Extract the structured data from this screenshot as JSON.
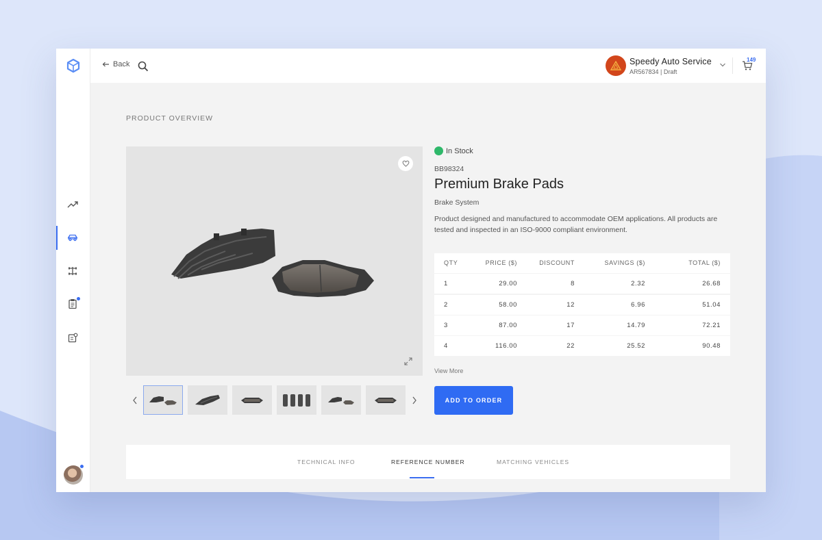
{
  "header": {
    "back_label": "Back",
    "account_name": "Speedy Auto Service",
    "account_sub": "AR567834  |  Draft",
    "cart_count": "149"
  },
  "page": {
    "section_title": "PRODUCT OVERVIEW"
  },
  "product": {
    "stock_status": "In Stock",
    "sku": "BB98324",
    "name": "Premium Brake Pads",
    "category": "Brake System",
    "description": "Product designed and manufactured to accommodate OEM applications. All products are tested and inspected in an ISO-9000 compliant environment."
  },
  "price_table": {
    "headers": [
      "QTY",
      "PRICE ($)",
      "DISCOUNT",
      "SAVINGS ($)",
      "TOTAL ($)"
    ],
    "rows": [
      [
        "1",
        "29.00",
        "8",
        "2.32",
        "26.68"
      ],
      [
        "2",
        "58.00",
        "12",
        "6.96",
        "51.04"
      ],
      [
        "3",
        "87.00",
        "17",
        "14.79",
        "72.21"
      ],
      [
        "4",
        "116.00",
        "22",
        "25.52",
        "90.48"
      ]
    ]
  },
  "actions": {
    "view_more": "View More",
    "add_to_order": "ADD TO ORDER"
  },
  "tabs": [
    {
      "label": "TECHNICAL INFO"
    },
    {
      "label": "REFERENCE NUMBER"
    },
    {
      "label": "MATCHING VEHICLES"
    }
  ],
  "colors": {
    "accent": "#2f6bf3",
    "in_stock": "#2fb86a",
    "account_avatar": "#d2461b"
  },
  "icons": {
    "logo": "cube-logo-icon",
    "nav": [
      "trend-icon",
      "car-icon",
      "axle-icon",
      "clipboard-icon",
      "settings-doc-icon"
    ]
  }
}
